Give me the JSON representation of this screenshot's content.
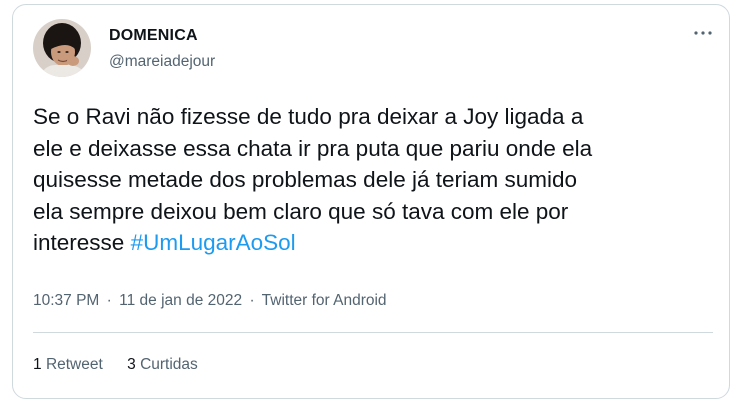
{
  "author": {
    "display_name": "DOMENICA",
    "handle": "@mareiadejour"
  },
  "tweet": {
    "text": "Se o Ravi não fizesse de tudo pra deixar a Joy ligada a\nele e deixasse essa chata ir pra puta que pariu onde ela\nquisesse metade dos problemas dele já teriam sumido\nela sempre deixou bem claro que só tava com ele por\ninteresse ",
    "hashtag": "#UmLugarAoSol"
  },
  "meta": {
    "time": "10:37 PM",
    "separator": "·",
    "date": "11 de jan de 2022",
    "source": "Twitter for Android"
  },
  "stats": {
    "retweets_count": "1",
    "retweets_label": "Retweet",
    "likes_count": "3",
    "likes_label": "Curtidas"
  },
  "icons": {
    "more": "more-options-icon"
  },
  "colors": {
    "text": "#0f1419",
    "secondary": "#536471",
    "link": "#1d9bf0",
    "border": "#cfd9de"
  }
}
